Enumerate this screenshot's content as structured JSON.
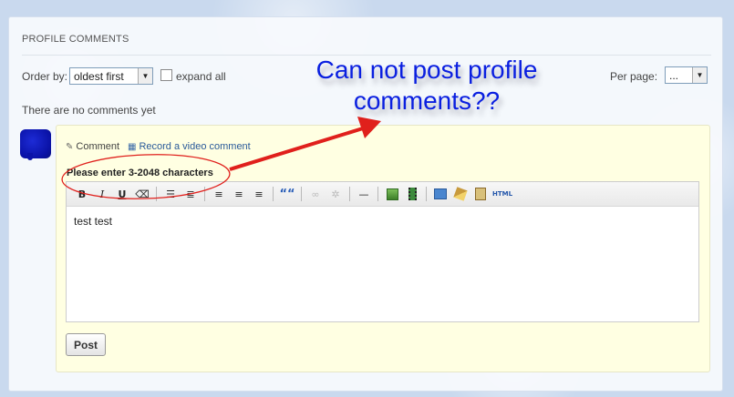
{
  "section": {
    "title": "PROFILE COMMENTS"
  },
  "controls": {
    "order_label": "Order by:",
    "order_value": "oldest first",
    "expand_label": "expand all",
    "perpage_label": "Per page:",
    "perpage_value": "..."
  },
  "comments": {
    "empty_text": "There are no comments yet"
  },
  "composer": {
    "tab_comment": "Comment",
    "tab_video": "Record a video comment",
    "error": "Please enter 3-2048 characters",
    "content": "test test",
    "post_label": "Post"
  },
  "toolbar": {
    "bold": "B",
    "italic": "I",
    "underline": "U",
    "quote": "““",
    "html": "HTML"
  },
  "annotation": {
    "line1": "Can not post profile",
    "line2": "comments??",
    "color": "#0a1fe0",
    "markup_color": "#e0201c"
  },
  "colors": {
    "comment_bg": "#ffffe2",
    "link": "#2a5a9a"
  }
}
